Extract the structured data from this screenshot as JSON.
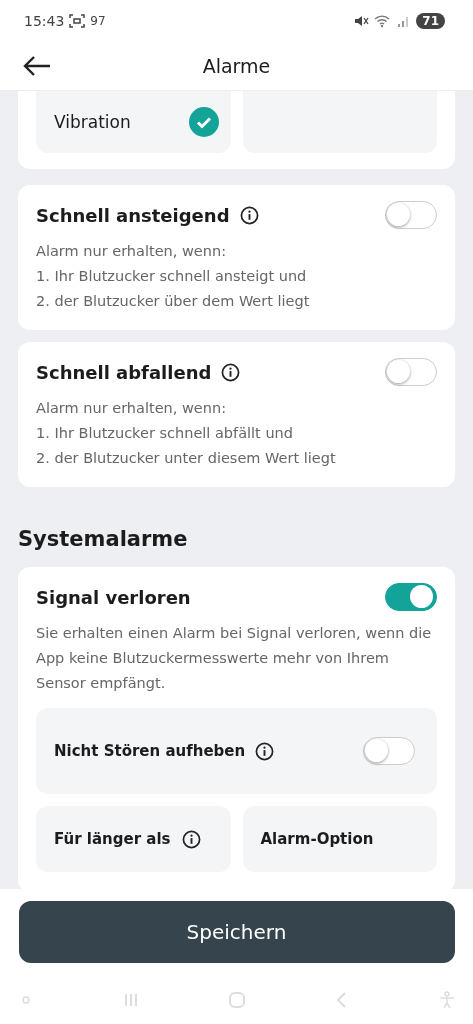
{
  "status_bar": {
    "time": "15:43",
    "notification_count": "97",
    "battery": "71"
  },
  "header": {
    "title": "Alarme"
  },
  "top_options": [
    {
      "label": "Vibration",
      "checked": true
    }
  ],
  "alarms": [
    {
      "title": "Schnell ansteigend",
      "info": true,
      "on": false,
      "lines": [
        "Alarm nur erhalten, wenn:",
        "1. Ihr Blutzucker schnell ansteigt und",
        "2. der Blutzucker über dem Wert liegt"
      ]
    },
    {
      "title": "Schnell abfallend",
      "info": true,
      "on": false,
      "lines": [
        "Alarm nur erhalten, wenn:",
        "1. Ihr Blutzucker schnell abfällt und",
        "2. der Blutzucker unter diesem Wert liegt"
      ]
    }
  ],
  "system_section": {
    "title": "Systemalarme",
    "alarm": {
      "title": "Signal verloren",
      "on": true,
      "description": "Sie erhalten einen Alarm bei Signal verloren, wenn die App keine Blutzuckermesswerte mehr von Ihrem Sensor empfängt.",
      "option": {
        "label": "Nicht Stören aufheben",
        "info": true,
        "on": false
      },
      "fields": [
        {
          "label": "Für länger als",
          "info": true
        },
        {
          "label": "Alarm-Option",
          "info": false
        }
      ]
    }
  },
  "save_button": "Speichern"
}
